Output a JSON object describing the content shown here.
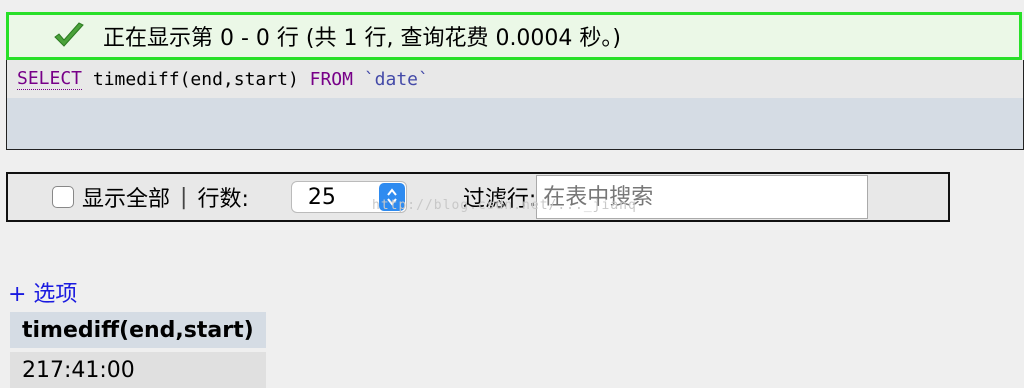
{
  "success": {
    "message": "正在显示第 0 - 0 行 (共 1 行, 查询花费 0.0004 秒。)",
    "border_color": "#28e028"
  },
  "sql": {
    "keyword_select": "SELECT",
    "expression": "timediff(end,start)",
    "keyword_from": "FROM",
    "table": "`date`"
  },
  "navbar": {
    "show_all_label": "显示全部",
    "separator": "|",
    "rows_label": "行数:",
    "rows_value": "25",
    "filter_label": "过滤行:",
    "search_placeholder": "在表中搜索"
  },
  "options_link": "+ 选项",
  "result": {
    "column": "timediff(end,start)",
    "rows": [
      "217:41:00"
    ]
  },
  "watermark": "http://blog.csdn.net/..._jianq"
}
